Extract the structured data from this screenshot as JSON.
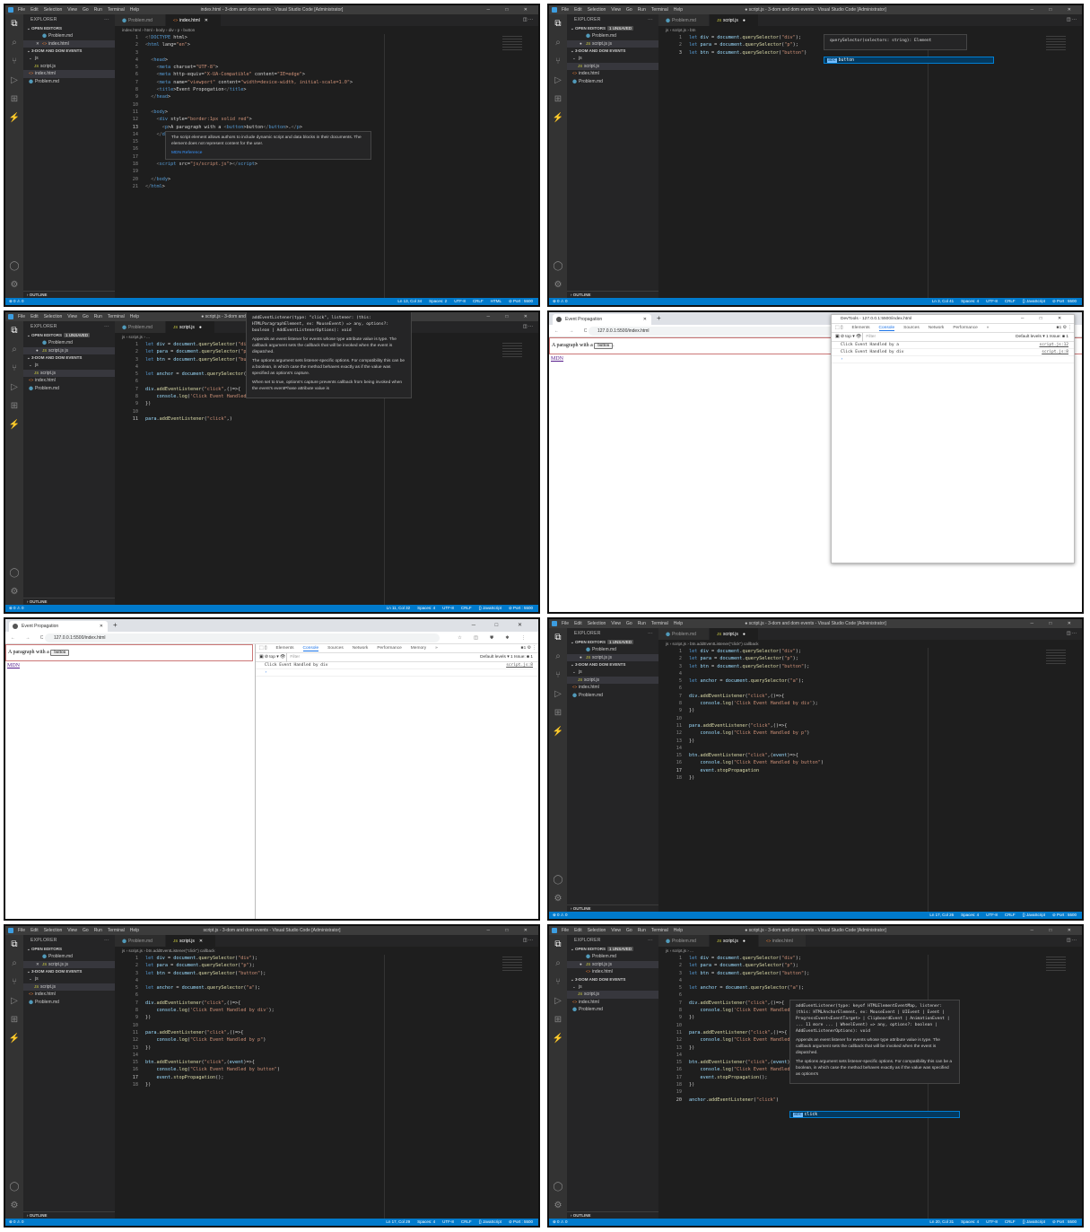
{
  "menu": [
    "File",
    "Edit",
    "Selection",
    "View",
    "Go",
    "Run",
    "Terminal",
    "Help"
  ],
  "window_controls": "─ □ ✕",
  "explorer_label": "EXPLORER",
  "open_editors_label": "OPEN EDITORS",
  "folder_label": "3-DOM AND DOM EVENTS",
  "outline_label": "OUTLINE",
  "status_left": "⊗ 0 ⚠ 0",
  "colors": {
    "status": "#007acc",
    "editor": "#1e1e1e",
    "sidebar": "#252526",
    "accent": "#1a73e8"
  },
  "panels": [
    {
      "type": "vscode",
      "title": "index.html - 3-dom and dom events - Visual Studio Code [Administrator]",
      "tabs": [
        {
          "label": "Problem.md",
          "icon": "⬤",
          "active": false,
          "mark": ""
        },
        {
          "label": "index.html",
          "icon": "<>",
          "active": true,
          "mark": "✕"
        }
      ],
      "unsaved_badge": "",
      "breadcrumb": "index.html › html › body › div › p › button",
      "open_files": [
        {
          "label": "Problem.md",
          "icon": "⬤",
          "prefix": ""
        },
        {
          "label": "index.html",
          "icon": "<>",
          "prefix": "✕"
        }
      ],
      "tree": [
        {
          "label": "js",
          "icon": "⌄",
          "indent": 1
        },
        {
          "label": "script.js",
          "icon": "JS",
          "indent": 2
        },
        {
          "label": "index.html",
          "icon": "<>",
          "indent": 1,
          "sel": true
        },
        {
          "label": "Problem.md",
          "icon": "⬤",
          "indent": 1
        }
      ],
      "current_line": 13,
      "code": [
        "<!DOCTYPE html>",
        "<html lang=\"en\">",
        "",
        "  <head>",
        "    <meta charset=\"UTF-8\">",
        "    <meta http-equiv=\"X-UA-Compatible\" content=\"IE=edge\">",
        "    <meta name=\"viewport\" content=\"width=device-width, initial-scale=1.0\">",
        "    <title>Event Propogation</title>",
        "  </head>",
        "",
        "  <body>",
        "    <div style=\"border:1px solid red\">",
        "      <p>A paragraph with a <button>button</button>.</p>",
        "    </div>",
        "",
        "",
        "",
        "    <script src=\"js/script.js\"></script>",
        "",
        "  </body>",
        "</html>"
      ],
      "hover": {
        "line": 14,
        "indent": 22,
        "width": 230,
        "sig": "",
        "paras": [
          "The script element allows authors to include dynamic script and data blocks in their documents. The element does not represent content for the user."
        ],
        "link": "MDN Reference"
      },
      "status": [
        "Ln 13, Col 34",
        "Spaces: 2",
        "UTF-8",
        "CRLF",
        "HTML",
        "⊘ Port : 5500"
      ]
    },
    {
      "type": "vscode",
      "title": "● script.js - 3-dom and dom events - Visual Studio Code [Administrator]",
      "tabs": [
        {
          "label": "Problem.md",
          "icon": "⬤",
          "active": false,
          "mark": ""
        },
        {
          "label": "script.js",
          "icon": "JS",
          "active": true,
          "mark": "●"
        }
      ],
      "unsaved_badge": "1 UNSAVED",
      "breadcrumb": "js › script.js › btn",
      "open_files": [
        {
          "label": "Problem.md",
          "icon": "⬤",
          "prefix": ""
        },
        {
          "label": "script.js js",
          "icon": "JS",
          "prefix": "●"
        }
      ],
      "tree": [
        {
          "label": "js",
          "icon": "⌄",
          "indent": 1
        },
        {
          "label": "script.js",
          "icon": "JS",
          "indent": 2,
          "sel": true
        },
        {
          "label": "index.html",
          "icon": "<>",
          "indent": 1
        },
        {
          "label": "Problem.md",
          "icon": "⬤",
          "indent": 1
        }
      ],
      "current_line": 3,
      "code": [
        "let div = document.querySelector(\"div\");",
        "let para = document.querySelector(\"p\");",
        "let btn = document.querySelector(\"button\")"
      ],
      "hover": {
        "line": 1,
        "indent": 150,
        "width": 160,
        "sig": "querySelector(selectors: string): Element",
        "paras": [],
        "link": ""
      },
      "suggestion": {
        "line": 3,
        "indent": 150,
        "width": 190,
        "label": "button"
      },
      "status": [
        "Ln 3, Col 41",
        "Spaces: 4",
        "UTF-8",
        "CRLF",
        "{} JavaScript",
        "⊘ Port : 5500"
      ]
    },
    {
      "type": "vscode",
      "title": "● script.js - 3-dom and dom events - Visual Studio Code [Administrator]",
      "tabs": [
        {
          "label": "Problem.md",
          "icon": "⬤",
          "active": false,
          "mark": ""
        },
        {
          "label": "script.js",
          "icon": "JS",
          "active": true,
          "mark": "●"
        }
      ],
      "unsaved_badge": "1 UNSAVED",
      "breadcrumb": "js › script.js › ...",
      "open_files": [
        {
          "label": "Problem.md",
          "icon": "⬤",
          "prefix": ""
        },
        {
          "label": "script.js js",
          "icon": "JS",
          "prefix": "●"
        }
      ],
      "tree": [
        {
          "label": "js",
          "icon": "⌄",
          "indent": 1
        },
        {
          "label": "script.js",
          "icon": "JS",
          "indent": 2,
          "sel": true
        },
        {
          "label": "index.html",
          "icon": "<>",
          "indent": 1
        },
        {
          "label": "Problem.md",
          "icon": "⬤",
          "indent": 1
        }
      ],
      "current_line": 11,
      "code": [
        "let div = document.querySelector(\"div\");",
        "let para = document.querySelector(\"p\");",
        "let btn = document.querySelector(\"button\");",
        "",
        "let anchor = document.querySelector(\"a\");",
        "",
        "div.addEventListener(\"click\",()=>{",
        "    console.log('Click Event Handled by div');",
        "})",
        "",
        "para.addEventListener(\"click\",)"
      ],
      "hover": {
        "line": -3,
        "indent": 112,
        "width": 185,
        "sig": "addEventListener(type: \"click\", listener: (this: HTMLParagraphElement, ev: MouseEvent) => any, options?: boolean | AddEventListenerOptions): void",
        "paras": [
          "Appends an event listener for events whose type attribute value is type. The callback argument sets the callback that will be invoked when the event is dispatched.",
          "The options argument sets listener-specific options. For compatibility this can be a boolean, in which case the method behaves exactly as if the value was specified as options's capture.",
          "When set to true, options's capture prevents callback from being invoked when the event's eventPhase attribute value is"
        ],
        "link": ""
      },
      "status": [
        "Ln 11, Col 32",
        "Spaces: 4",
        "UTF-8",
        "CRLF",
        "{} JavaScript",
        "⊘ Port : 5500"
      ]
    },
    {
      "type": "browser",
      "tab_label": "Event Propagation",
      "url": "127.0.0.1:5500/index.html",
      "page_text": "A paragraph with a",
      "page_button": "button",
      "page_after": ".",
      "page_link": "MDN",
      "devtools": {
        "floating": true,
        "title": "DevTools - 127.0.0.1:5500/index.html",
        "tabs": [
          "Elements",
          "Console",
          "Sources",
          "Network",
          "Performance",
          "»"
        ],
        "active_tab": "Console",
        "context": "top ▾",
        "filter_placeholder": "Filter",
        "levels": "Default levels ▾",
        "issues": "1 Issue: ■ 1",
        "logs": [
          {
            "text": "Click Event Handled by a",
            "src": "script.js:12"
          },
          {
            "text": "Click Event Handled by div",
            "src": "script.js:8"
          }
        ]
      }
    },
    {
      "type": "browser",
      "tab_label": "Event Propagation",
      "url": "127.0.0.1:5500/index.html",
      "page_text": "A paragraph with a",
      "page_button": "button",
      "page_after": "",
      "page_link": "MDN",
      "devtools": {
        "floating": false,
        "title": "",
        "tabs": [
          "Elements",
          "Console",
          "Sources",
          "Network",
          "Performance",
          "Memory",
          "»"
        ],
        "active_tab": "Console",
        "context": "top ▾",
        "filter_placeholder": "Filter",
        "levels": "Default levels ▾",
        "issues": "1 Issue: ■ 1",
        "logs": [
          {
            "text": "Click Event Handled by div",
            "src": "script.js:8"
          }
        ]
      }
    },
    {
      "type": "vscode",
      "title": "● script.js - 3-dom and dom events - Visual Studio Code [Administrator]",
      "tabs": [
        {
          "label": "Problem.md",
          "icon": "⬤",
          "active": false,
          "mark": ""
        },
        {
          "label": "script.js",
          "icon": "JS",
          "active": true,
          "mark": "●"
        }
      ],
      "unsaved_badge": "1 UNSAVED",
      "breadcrumb": "js › script.js › btn.addEventListener(\"click\") callback",
      "open_files": [
        {
          "label": "Problem.md",
          "icon": "⬤",
          "prefix": ""
        },
        {
          "label": "script.js js",
          "icon": "JS",
          "prefix": "●"
        }
      ],
      "tree": [
        {
          "label": "js",
          "icon": "⌄",
          "indent": 1
        },
        {
          "label": "script.js",
          "icon": "JS",
          "indent": 2,
          "sel": true
        },
        {
          "label": "index.html",
          "icon": "<>",
          "indent": 1
        },
        {
          "label": "Problem.md",
          "icon": "⬤",
          "indent": 1
        }
      ],
      "current_line": 17,
      "code": [
        "let div = document.querySelector(\"div\");",
        "let para = document.querySelector(\"p\");",
        "let btn = document.querySelector(\"button\");",
        "",
        "let anchor = document.querySelector(\"a\");",
        "",
        "div.addEventListener(\"click\",()=>{",
        "    console.log('Click Event Handled by div');",
        "})",
        "",
        "para.addEventListener(\"click\",()=>{",
        "    console.log(\"Click Event Handled by p\")",
        "})",
        "",
        "btn.addEventListener(\"click\",(event)=>{",
        "    console.log(\"Click Event Handled by button\")",
        "    event.stopPropagation",
        "})"
      ],
      "status": [
        "Ln 17, Col 26",
        "Spaces: 4",
        "UTF-8",
        "CRLF",
        "{} JavaScript",
        "⊘ Port : 5500"
      ]
    },
    {
      "type": "vscode",
      "title": "script.js - 3-dom and dom events - Visual Studio Code [Administrator]",
      "tabs": [
        {
          "label": "Problem.md",
          "icon": "⬤",
          "active": false,
          "mark": ""
        },
        {
          "label": "script.js",
          "icon": "JS",
          "active": true,
          "mark": "✕"
        }
      ],
      "unsaved_badge": "",
      "breadcrumb": "js › script.js › btn.addEventListener(\"click\") callback",
      "open_files": [
        {
          "label": "Problem.md",
          "icon": "⬤",
          "prefix": ""
        },
        {
          "label": "script.js js",
          "icon": "JS",
          "prefix": "✕"
        }
      ],
      "tree": [
        {
          "label": "js",
          "icon": "⌄",
          "indent": 1
        },
        {
          "label": "script.js",
          "icon": "JS",
          "indent": 2,
          "sel": true
        },
        {
          "label": "index.html",
          "icon": "<>",
          "indent": 1
        },
        {
          "label": "Problem.md",
          "icon": "⬤",
          "indent": 1
        }
      ],
      "current_line": 17,
      "code": [
        "let div = document.querySelector(\"div\");",
        "let para = document.querySelector(\"p\");",
        "let btn = document.querySelector(\"button\");",
        "",
        "let anchor = document.querySelector(\"a\");",
        "",
        "div.addEventListener(\"click\",()=>{",
        "    console.log('Click Event Handled by div');",
        "})",
        "",
        "para.addEventListener(\"click\",()=>{",
        "    console.log(\"Click Event Handled by p\")",
        "})",
        "",
        "btn.addEventListener(\"click\",(event)=>{",
        "    console.log(\"Click Event Handled by button\")",
        "    event.stopPropagation();",
        "})"
      ],
      "status": [
        "Ln 17, Col 29",
        "Spaces: 4",
        "UTF-8",
        "CRLF",
        "{} JavaScript",
        "⊘ Port : 5500"
      ]
    },
    {
      "type": "vscode",
      "title": "● script.js - 3-dom and dom events - Visual Studio Code [Administrator]",
      "tabs": [
        {
          "label": "Problem.md",
          "icon": "⬤",
          "active": false,
          "mark": ""
        },
        {
          "label": "script.js",
          "icon": "JS",
          "active": true,
          "mark": "●"
        },
        {
          "label": "index.html",
          "icon": "<>",
          "active": false,
          "mark": ""
        }
      ],
      "unsaved_badge": "1 UNSAVED",
      "breadcrumb": "js › script.js › ...",
      "open_files": [
        {
          "label": "Problem.md",
          "icon": "⬤",
          "prefix": ""
        },
        {
          "label": "script.js js",
          "icon": "JS",
          "prefix": "●"
        },
        {
          "label": "index.html",
          "icon": "<>",
          "prefix": ""
        }
      ],
      "tree": [
        {
          "label": "js",
          "icon": "⌄",
          "indent": 1
        },
        {
          "label": "script.js",
          "icon": "JS",
          "indent": 2,
          "sel": true
        },
        {
          "label": "index.html",
          "icon": "<>",
          "indent": 1
        },
        {
          "label": "Problem.md",
          "icon": "⬤",
          "indent": 1
        }
      ],
      "current_line": 20,
      "code": [
        "let div = document.querySelector(\"div\");",
        "let para = document.querySelector(\"p\");",
        "let btn = document.querySelector(\"button\");",
        "",
        "let anchor = document.querySelector(\"a\");",
        "",
        "div.addEventListener(\"click\",()=>{",
        "    console.log('Click Event Handled by div');",
        "})",
        "",
        "para.addEventListener(\"click\",()=>{",
        "    console.log(\"Click Event Handled by p\")",
        "})",
        "",
        "btn.addEventListener(\"click\",(event)=>{",
        "    console.log(\"Click Event Handled by button\")",
        "    event.stopPropagation();",
        "})",
        "",
        "anchor.addEventListener(\"click\")"
      ],
      "hover": {
        "line": 7,
        "indent": 112,
        "width": 190,
        "sig": "addEventListener(type: keyof HTMLElementEventMap, listener: (this: HTMLAnchorElement, ev: MouseEvent | UIEvent | Event | ProgressEvent<EventTarget> | ClipboardEvent | AnimationEvent | ... 11 more ... | WheelEvent) => any, options?: boolean | AddEventListenerOptions): void",
        "paras": [
          "Appends an event listener for events whose type attribute value is type. The callback argument sets the callback that will be invoked when the event is dispatched.",
          "The options argument sets listener-specific options. For compatibility this can be a boolean, in which case the method behaves exactly as if the value was specified as options's"
        ],
        "link": ""
      },
      "suggestion": {
        "line": 21,
        "indent": 112,
        "width": 190,
        "label": "click"
      },
      "status": [
        "Ln 20, Col 31",
        "Spaces: 4",
        "UTF-8",
        "CRLF",
        "{} JavaScript",
        "⊘ Port : 5500"
      ]
    }
  ]
}
